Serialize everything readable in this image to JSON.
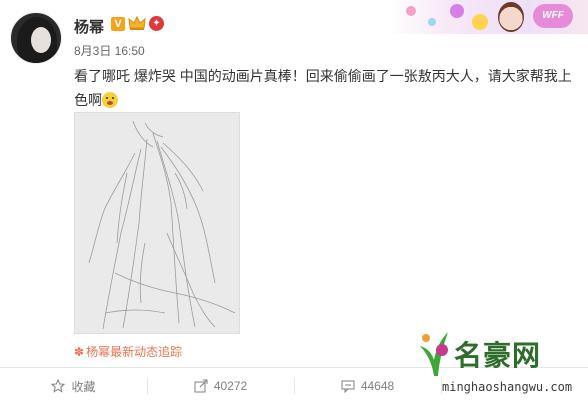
{
  "post": {
    "username": "杨幂",
    "v_badge": "V",
    "timestamp": "8月3日 16:50",
    "text": "看了哪吒 爆炸哭 中国的动画片真棒！回来偷偷画了一张敖丙大人，请大家帮我上色啊",
    "tracking_text": "杨幂最新动态追踪"
  },
  "banner": {
    "badge_text": "WFF"
  },
  "actions": {
    "favorite_label": "收藏",
    "share_count": "40272",
    "comment_count": "44648"
  },
  "watermark": {
    "logo_text": "名豪网",
    "url": "minghaoshangwu.com"
  },
  "colors": {
    "accent": "#eb7350",
    "v_badge": "#f7a21b",
    "watermark_green": "#2d6c2a"
  },
  "icons": {
    "favorite": "star-outline-icon",
    "share": "share-icon",
    "comment": "comment-icon"
  }
}
